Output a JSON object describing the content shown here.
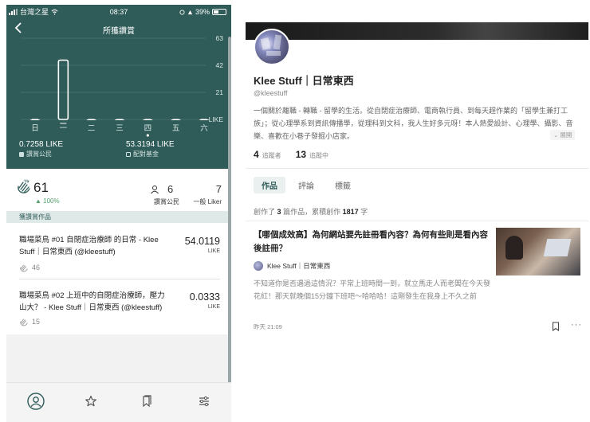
{
  "status_bar": {
    "carrier": "台灣之星",
    "time": "08:37",
    "battery": "39%"
  },
  "header": {
    "title": "所獲讚賞",
    "back_icon": "chevron-left-icon"
  },
  "chart_data": {
    "type": "bar",
    "categories": [
      "日",
      "一",
      "二",
      "三",
      "四",
      "五",
      "六"
    ],
    "values": [
      0,
      46,
      0,
      0,
      0,
      0,
      0
    ],
    "selected_index": 4,
    "highlighted_index": 1,
    "y_tick_labels": [
      "63",
      "42",
      "21",
      "LIKE"
    ],
    "y_ticks": [
      63,
      42,
      21,
      0
    ],
    "ylim": [
      0,
      63
    ],
    "grid": true,
    "colors": {
      "bar_fill": "#ffffff",
      "bar_outline": "#ffffff",
      "axis_text": "#d9e6e4",
      "grid": "#5d807d"
    }
  },
  "summary": {
    "civic": {
      "value": "0.7258 LIKE",
      "label": "讚賞公民"
    },
    "matched": {
      "value": "53.3194 LIKE",
      "label": "配對基金"
    }
  },
  "stats": {
    "claps": "61",
    "claps_change": "100%",
    "civic_liker_count": "6",
    "civic_liker_label": "讚賞公民",
    "general_liker_count": "7",
    "general_liker_label": "一般 Liker"
  },
  "works_section_title": "獲讚賞作品",
  "works": [
    {
      "title": "職場菜鳥 #01 自閉症治療師 的日常 - Klee Stuff｜日常東西 (@kleestuff)",
      "value": "54.0119",
      "unit": "LIKE",
      "claps": "46"
    },
    {
      "title": "職場菜鳥 #02 上班中的自閉症治療師，壓力山大？ - Klee Stuff｜日常東西 (@kleestuff)",
      "value": "0.0333",
      "unit": "LIKE",
      "claps": "15"
    }
  ],
  "tabbar": [
    "person-circle-icon",
    "star-icon",
    "bookmarks-icon",
    "sliders-icon"
  ],
  "profile": {
    "name": "Klee Stuff｜日常東西",
    "handle": "@kleestuff",
    "bio": "一個關於離職 - 轉職 - 留學的生活。從自閉症治療師、電商執行員、到每天趕作業的「留學生兼打工族」；從心理學系到資訊傳播學，從理科到文科，我人生好多元呀！本人熱愛設計、心理學、攝影、音樂、喜歡在小巷子發掘小店家。",
    "expand_label": "展開",
    "followers_count": "4",
    "followers_label": "追蹤者",
    "following_count": "13",
    "following_label": "追蹤中",
    "tabs": [
      "作品",
      "評論",
      "標籤"
    ],
    "summary_prefix": "創作了",
    "works_count": "3",
    "summary_mid": "篇作品，累積創作",
    "chars_count": "1817",
    "summary_suffix": "字"
  },
  "article": {
    "title": "【哪個成效高】為何網站要先註冊看內容？為何有些則是看內容後註冊？",
    "author": "Klee Stuff｜日常東西",
    "excerpt": "不知道你是否遇過這情況？平常上班時間一到，就立馬走人而老闆在今天發花紅！那天就晚個15分鐘下班吧～哈哈哈！這剛發生在我身上不久之前",
    "time": "昨天 21:09"
  }
}
